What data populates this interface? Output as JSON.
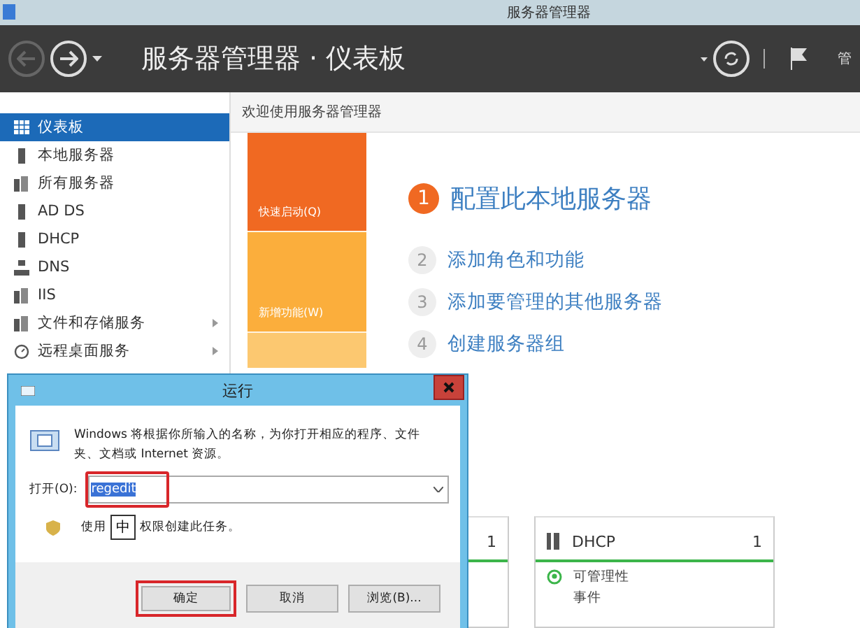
{
  "window": {
    "title": "服务器管理器"
  },
  "header": {
    "title": "服务器管理器",
    "separator": "·",
    "page": "仪表板",
    "account": "管"
  },
  "sidebar": {
    "items": [
      {
        "label": "仪表板",
        "kind": "grid",
        "selected": true,
        "expandable": false
      },
      {
        "label": "本地服务器",
        "kind": "server",
        "selected": false,
        "expandable": false
      },
      {
        "label": "所有服务器",
        "kind": "servers",
        "selected": false,
        "expandable": false
      },
      {
        "label": "AD DS",
        "kind": "server",
        "selected": false,
        "expandable": false
      },
      {
        "label": "DHCP",
        "kind": "server",
        "selected": false,
        "expandable": false
      },
      {
        "label": "DNS",
        "kind": "network",
        "selected": false,
        "expandable": false
      },
      {
        "label": "IIS",
        "kind": "servers",
        "selected": false,
        "expandable": false
      },
      {
        "label": "文件和存储服务",
        "kind": "servers",
        "selected": false,
        "expandable": true
      },
      {
        "label": "远程桌面服务",
        "kind": "gauge",
        "selected": false,
        "expandable": true
      }
    ]
  },
  "welcome": {
    "title": "欢迎使用服务器管理器"
  },
  "quick_start": {
    "tiles": [
      {
        "label": "快速启动(Q)",
        "kind": "dark"
      },
      {
        "label": "新增功能(W)",
        "kind": "light"
      },
      {
        "kind": "pale"
      }
    ],
    "steps": [
      {
        "number": "1",
        "label": "配置此本地服务器",
        "kind": "primary"
      },
      {
        "number": "2",
        "label": "添加角色和功能",
        "kind": "secondary"
      },
      {
        "number": "3",
        "label": "添加要管理的其他服务器",
        "kind": "secondary"
      },
      {
        "number": "4",
        "label": "创建服务器组",
        "kind": "secondary"
      }
    ]
  },
  "role_tiles": [
    {
      "count": "1"
    },
    {
      "name": "DHCP",
      "count": "1",
      "status": "可管理性",
      "next": "事件"
    }
  ],
  "run_dialog": {
    "title": "运行",
    "description": "Windows 将根据你所输入的名称，为你打开相应的程序、文件夹、文档或 Internet 资源。",
    "open_label": "打开(O):",
    "value": "regedit",
    "value_selected": true,
    "value_highlighted": true,
    "admin_before": "使用",
    "ime": "中",
    "admin_after": "权限创建此任务。",
    "buttons": [
      {
        "label": "确定",
        "highlighted": true
      },
      {
        "label": "取消",
        "highlighted": false
      },
      {
        "label": "浏览(B)...",
        "highlighted": false
      }
    ]
  }
}
